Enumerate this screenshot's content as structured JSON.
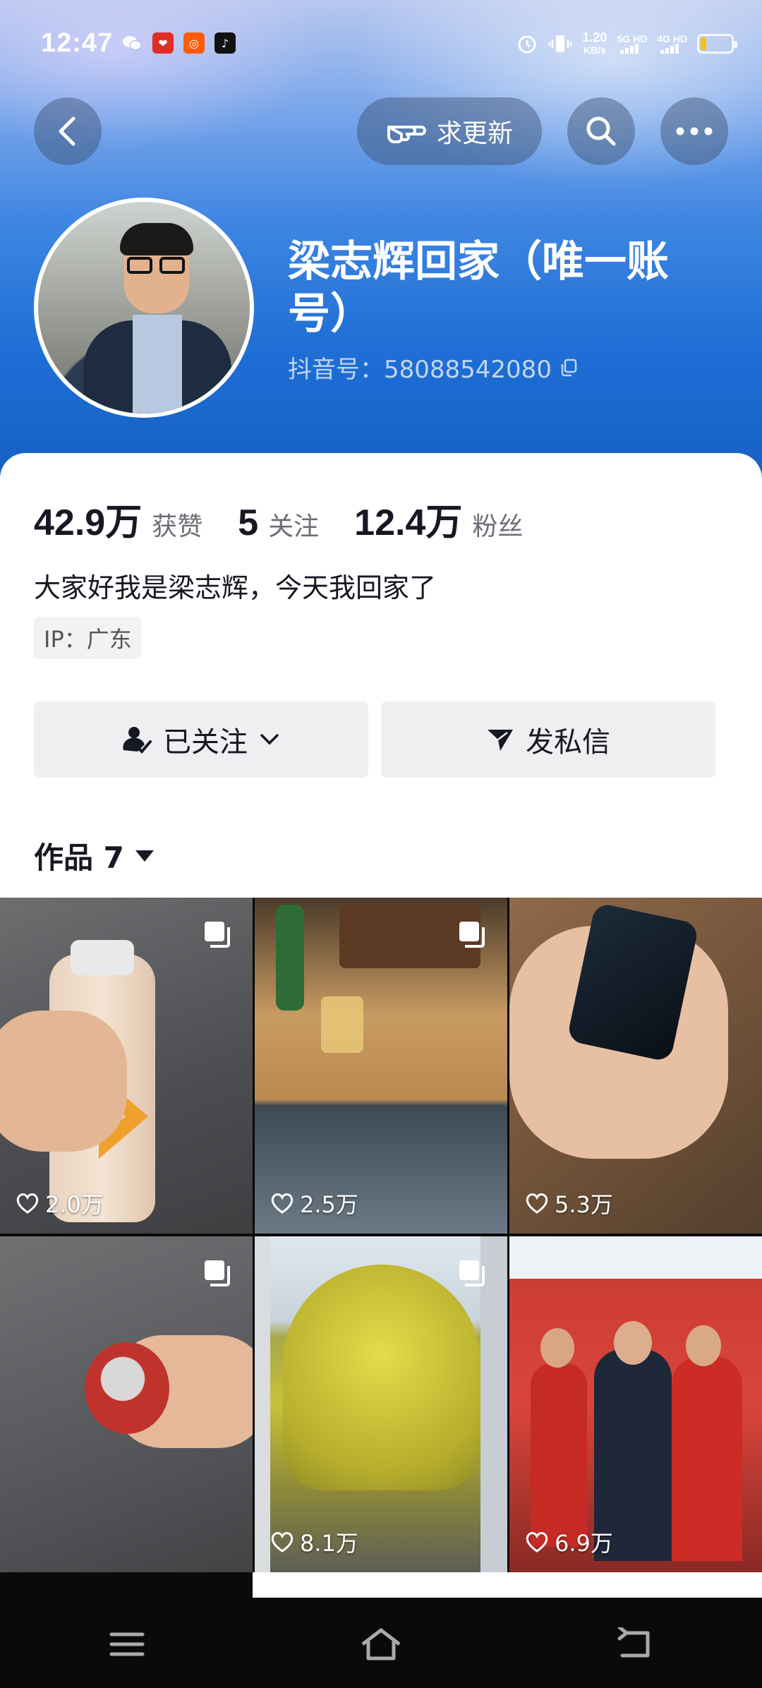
{
  "status_bar": {
    "time": "12:47",
    "net_speed_value": "1.20",
    "net_speed_unit": "KB/s",
    "sim1": "5G HD",
    "sim2": "4G HD",
    "battery_level": 0.2,
    "battery_color": "#f6c21a"
  },
  "header": {
    "update_label": "求更新",
    "back_icon": "chevron-left-icon",
    "search_icon": "search-icon",
    "more_icon": "more-icon"
  },
  "profile": {
    "name": "梁志辉回家（唯一账号）",
    "douyin_id": "抖音号：58088542080",
    "stats": [
      {
        "value": "42.9万",
        "label": "获赞"
      },
      {
        "value": "5",
        "label": "关注"
      },
      {
        "value": "12.4万",
        "label": "粉丝"
      }
    ],
    "bio": "大家好我是梁志辉，今天我回家了",
    "ip": "IP：广东"
  },
  "actions": {
    "follow_label": "已关注",
    "message_label": "发私信"
  },
  "works_tab": {
    "label": "作品 7"
  },
  "works": [
    {
      "likes": "2.0万",
      "multi": true
    },
    {
      "likes": "2.5万",
      "multi": true
    },
    {
      "likes": "5.3万",
      "multi": false
    },
    {
      "likes": "",
      "multi": true
    },
    {
      "likes": "8.1万",
      "multi": true
    },
    {
      "likes": "6.9万",
      "multi": false
    }
  ],
  "colors": {
    "header_blue": "#1f6fd6",
    "text_primary": "#161823",
    "text_secondary": "#6b6e76",
    "button_bg": "#efeff1"
  }
}
